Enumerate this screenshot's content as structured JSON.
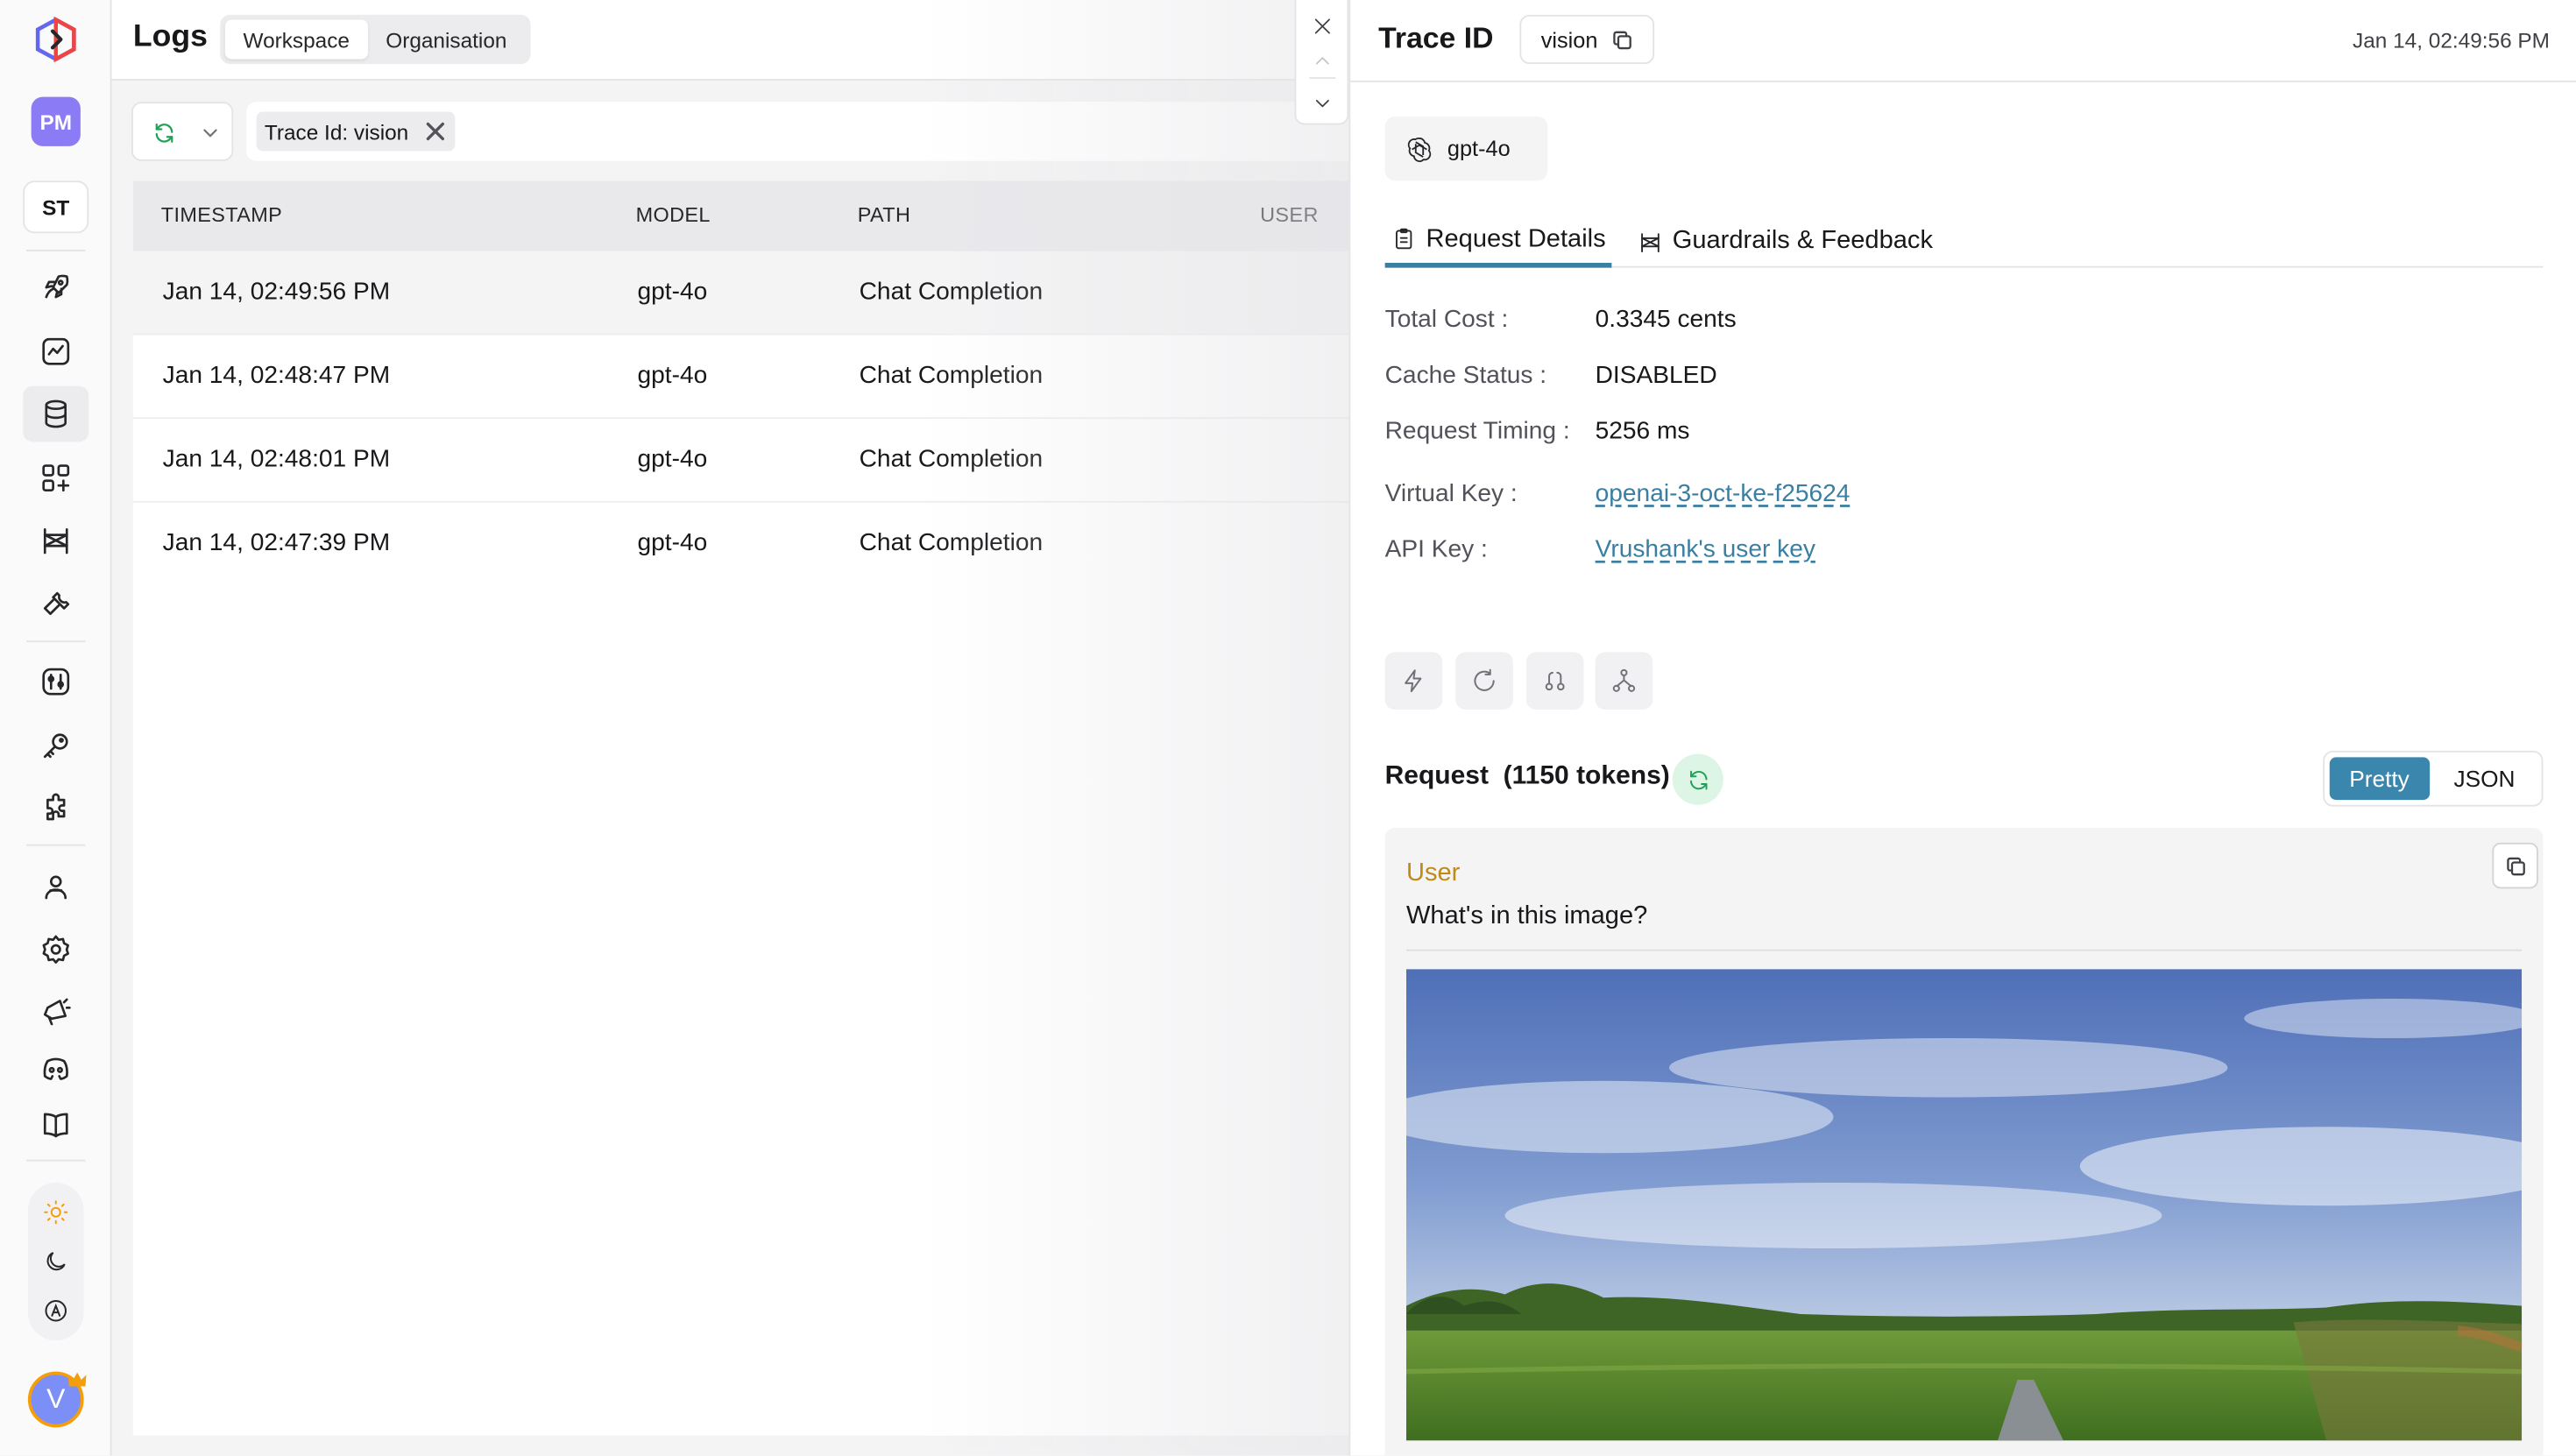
{
  "header": {
    "title": "Logs",
    "scopes": [
      "Workspace",
      "Organisation"
    ],
    "active_scope": "Workspace"
  },
  "sidebar": {
    "workspace_badge": "PM",
    "team_badge": "ST",
    "avatar_initial": "V",
    "items": [
      {
        "icon": "rocket-icon"
      },
      {
        "icon": "analytics-icon"
      },
      {
        "icon": "database-icon",
        "active": true
      },
      {
        "icon": "apps-plus-icon"
      },
      {
        "icon": "guardrails-icon"
      },
      {
        "icon": "wrench-icon"
      },
      {
        "icon": "sliders-icon"
      },
      {
        "icon": "key-icon"
      },
      {
        "icon": "puzzle-icon"
      },
      {
        "icon": "team-icon"
      },
      {
        "icon": "gear-icon"
      },
      {
        "icon": "megaphone-icon"
      },
      {
        "icon": "discord-icon"
      },
      {
        "icon": "book-icon"
      }
    ],
    "theme_options": [
      "light-theme-icon",
      "dark-theme-icon",
      "auto-theme-icon"
    ]
  },
  "filter": {
    "chip_label": "Trace Id: vision"
  },
  "table": {
    "columns": [
      "TIMESTAMP",
      "MODEL",
      "PATH",
      "USER"
    ],
    "rows": [
      {
        "timestamp": "Jan 14, 02:49:56 PM",
        "model": "gpt-4o",
        "path": "Chat Completion",
        "user": ""
      },
      {
        "timestamp": "Jan 14, 02:48:47 PM",
        "model": "gpt-4o",
        "path": "Chat Completion",
        "user": ""
      },
      {
        "timestamp": "Jan 14, 02:48:01 PM",
        "model": "gpt-4o",
        "path": "Chat Completion",
        "user": ""
      },
      {
        "timestamp": "Jan 14, 02:47:39 PM",
        "model": "gpt-4o",
        "path": "Chat Completion",
        "user": ""
      }
    ]
  },
  "detail": {
    "title": "Trace ID",
    "trace_value": "vision",
    "timestamp": "Jan 14, 02:49:56 PM",
    "model": "gpt-4o",
    "tabs": [
      "Request Details",
      "Guardrails & Feedback"
    ],
    "active_tab": "Request Details",
    "fields": {
      "total_cost_label": "Total Cost :",
      "total_cost": "0.3345 cents",
      "cache_status_label": "Cache Status :",
      "cache_status": "DISABLED",
      "request_timing_label": "Request Timing :",
      "request_timing": "5256 ms",
      "virtual_key_label": "Virtual Key :",
      "virtual_key": "openai-3-oct-ke-f25624",
      "api_key_label": "API Key :",
      "api_key": "Vrushank's user key"
    },
    "request": {
      "title": "Request",
      "tokens": "(1150 tokens)",
      "view_modes": [
        "Pretty",
        "JSON"
      ],
      "active_view": "Pretty",
      "message_role": "User",
      "message_text": "What's in this image?"
    }
  },
  "colors": {
    "accent": "#3a86ad",
    "badge_purple": "#8b7cf6",
    "role_color": "#c08a16",
    "refresh_green": "#22a05a"
  }
}
